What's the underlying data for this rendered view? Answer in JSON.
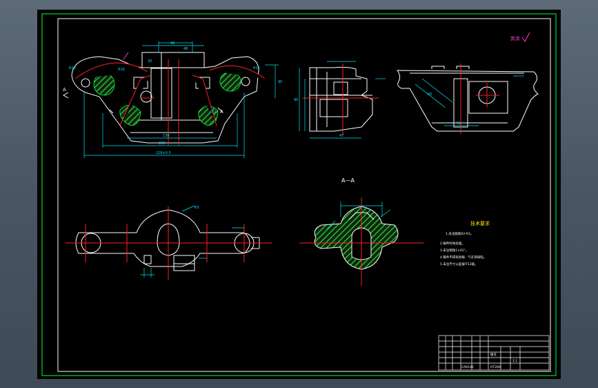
{
  "drawing": {
    "section_label": "A—A",
    "view_marker_left": "A",
    "view_marker_right": "A",
    "surface_finish_note": "其余",
    "tech_requirements_title": "技术要求",
    "tech_requirements": [
      "1.未注圆角R2-R3。",
      "2.铸件时效处理。",
      "3.未注倒角1×45°。",
      "4.铸件不得有砂眼、气孔等缺陷。",
      "5.未注尺寸公差按IT12级。"
    ],
    "dimensions": {
      "d_top_1": "40",
      "d_top_2": "30",
      "d_top_3": "48",
      "d_bottom_1": "130",
      "d_bottom_2": "226±0.5",
      "d_bottom_3": "200",
      "d_side_1": "90",
      "d_side_2": "47",
      "d_side_3": "90",
      "d_r1": "R18",
      "d_r2": "R16",
      "d_r3": "R10",
      "d_r4": "R12",
      "d_r5": "R5",
      "d_r6": "R2",
      "d_r7": "R3"
    },
    "title_block": {
      "part_name": "拨叉",
      "drawing_no": "CA6140",
      "scale": "1:1",
      "material": "HT200"
    }
  },
  "colors": {
    "outline": "#ffffff",
    "center_line": "#ff2020",
    "dimension": "#00e5ff",
    "hatch": "#00ff3c",
    "frame_outer": "#ffffff",
    "frame_inner": "#00ff3c",
    "annotation": "#ff3ad6"
  }
}
